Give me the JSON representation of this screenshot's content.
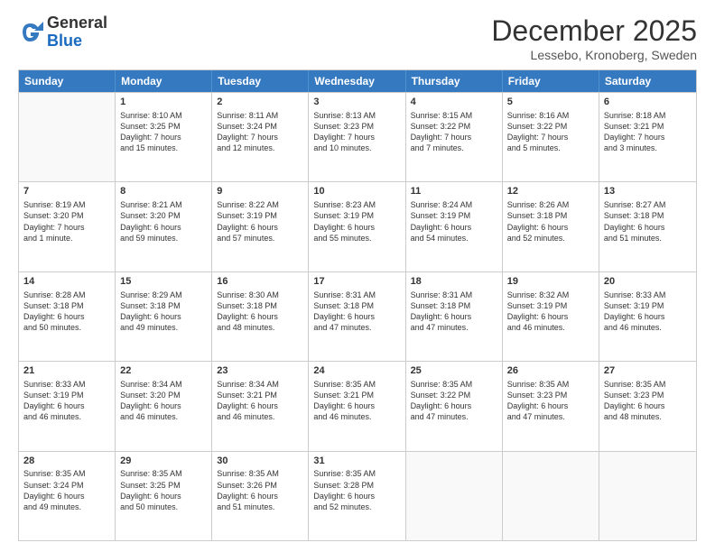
{
  "header": {
    "logo_general": "General",
    "logo_blue": "Blue",
    "month_title": "December 2025",
    "location": "Lessebo, Kronoberg, Sweden"
  },
  "days_of_week": [
    "Sunday",
    "Monday",
    "Tuesday",
    "Wednesday",
    "Thursday",
    "Friday",
    "Saturday"
  ],
  "weeks": [
    [
      {
        "day": "",
        "info": ""
      },
      {
        "day": "1",
        "info": "Sunrise: 8:10 AM\nSunset: 3:25 PM\nDaylight: 7 hours\nand 15 minutes."
      },
      {
        "day": "2",
        "info": "Sunrise: 8:11 AM\nSunset: 3:24 PM\nDaylight: 7 hours\nand 12 minutes."
      },
      {
        "day": "3",
        "info": "Sunrise: 8:13 AM\nSunset: 3:23 PM\nDaylight: 7 hours\nand 10 minutes."
      },
      {
        "day": "4",
        "info": "Sunrise: 8:15 AM\nSunset: 3:22 PM\nDaylight: 7 hours\nand 7 minutes."
      },
      {
        "day": "5",
        "info": "Sunrise: 8:16 AM\nSunset: 3:22 PM\nDaylight: 7 hours\nand 5 minutes."
      },
      {
        "day": "6",
        "info": "Sunrise: 8:18 AM\nSunset: 3:21 PM\nDaylight: 7 hours\nand 3 minutes."
      }
    ],
    [
      {
        "day": "7",
        "info": "Sunrise: 8:19 AM\nSunset: 3:20 PM\nDaylight: 7 hours\nand 1 minute."
      },
      {
        "day": "8",
        "info": "Sunrise: 8:21 AM\nSunset: 3:20 PM\nDaylight: 6 hours\nand 59 minutes."
      },
      {
        "day": "9",
        "info": "Sunrise: 8:22 AM\nSunset: 3:19 PM\nDaylight: 6 hours\nand 57 minutes."
      },
      {
        "day": "10",
        "info": "Sunrise: 8:23 AM\nSunset: 3:19 PM\nDaylight: 6 hours\nand 55 minutes."
      },
      {
        "day": "11",
        "info": "Sunrise: 8:24 AM\nSunset: 3:19 PM\nDaylight: 6 hours\nand 54 minutes."
      },
      {
        "day": "12",
        "info": "Sunrise: 8:26 AM\nSunset: 3:18 PM\nDaylight: 6 hours\nand 52 minutes."
      },
      {
        "day": "13",
        "info": "Sunrise: 8:27 AM\nSunset: 3:18 PM\nDaylight: 6 hours\nand 51 minutes."
      }
    ],
    [
      {
        "day": "14",
        "info": "Sunrise: 8:28 AM\nSunset: 3:18 PM\nDaylight: 6 hours\nand 50 minutes."
      },
      {
        "day": "15",
        "info": "Sunrise: 8:29 AM\nSunset: 3:18 PM\nDaylight: 6 hours\nand 49 minutes."
      },
      {
        "day": "16",
        "info": "Sunrise: 8:30 AM\nSunset: 3:18 PM\nDaylight: 6 hours\nand 48 minutes."
      },
      {
        "day": "17",
        "info": "Sunrise: 8:31 AM\nSunset: 3:18 PM\nDaylight: 6 hours\nand 47 minutes."
      },
      {
        "day": "18",
        "info": "Sunrise: 8:31 AM\nSunset: 3:18 PM\nDaylight: 6 hours\nand 47 minutes."
      },
      {
        "day": "19",
        "info": "Sunrise: 8:32 AM\nSunset: 3:19 PM\nDaylight: 6 hours\nand 46 minutes."
      },
      {
        "day": "20",
        "info": "Sunrise: 8:33 AM\nSunset: 3:19 PM\nDaylight: 6 hours\nand 46 minutes."
      }
    ],
    [
      {
        "day": "21",
        "info": "Sunrise: 8:33 AM\nSunset: 3:19 PM\nDaylight: 6 hours\nand 46 minutes."
      },
      {
        "day": "22",
        "info": "Sunrise: 8:34 AM\nSunset: 3:20 PM\nDaylight: 6 hours\nand 46 minutes."
      },
      {
        "day": "23",
        "info": "Sunrise: 8:34 AM\nSunset: 3:21 PM\nDaylight: 6 hours\nand 46 minutes."
      },
      {
        "day": "24",
        "info": "Sunrise: 8:35 AM\nSunset: 3:21 PM\nDaylight: 6 hours\nand 46 minutes."
      },
      {
        "day": "25",
        "info": "Sunrise: 8:35 AM\nSunset: 3:22 PM\nDaylight: 6 hours\nand 47 minutes."
      },
      {
        "day": "26",
        "info": "Sunrise: 8:35 AM\nSunset: 3:23 PM\nDaylight: 6 hours\nand 47 minutes."
      },
      {
        "day": "27",
        "info": "Sunrise: 8:35 AM\nSunset: 3:23 PM\nDaylight: 6 hours\nand 48 minutes."
      }
    ],
    [
      {
        "day": "28",
        "info": "Sunrise: 8:35 AM\nSunset: 3:24 PM\nDaylight: 6 hours\nand 49 minutes."
      },
      {
        "day": "29",
        "info": "Sunrise: 8:35 AM\nSunset: 3:25 PM\nDaylight: 6 hours\nand 50 minutes."
      },
      {
        "day": "30",
        "info": "Sunrise: 8:35 AM\nSunset: 3:26 PM\nDaylight: 6 hours\nand 51 minutes."
      },
      {
        "day": "31",
        "info": "Sunrise: 8:35 AM\nSunset: 3:28 PM\nDaylight: 6 hours\nand 52 minutes."
      },
      {
        "day": "",
        "info": ""
      },
      {
        "day": "",
        "info": ""
      },
      {
        "day": "",
        "info": ""
      }
    ]
  ]
}
